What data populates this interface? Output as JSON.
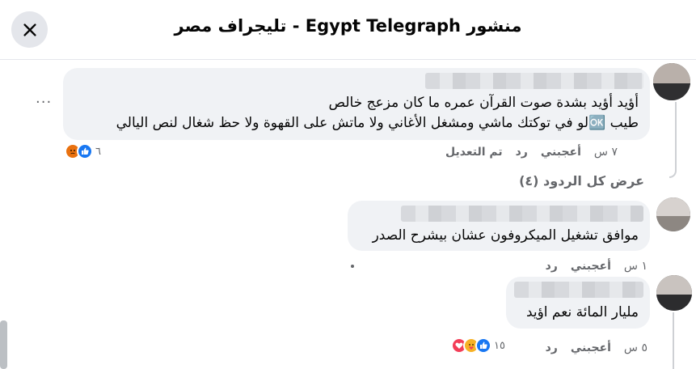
{
  "header": {
    "title": "منشور Egypt Telegraph - تليجراف مصر",
    "close_icon": "close-icon"
  },
  "comments": [
    {
      "line1": "أؤيد أؤيد بشدة صوت القرآن عمره ما كان مزعج خالص",
      "line2": "طيب 🆗لو في توكتك ماشي ومشغل الأغاني ولا ماتش على القهوة ولا حظ شغال لنص اليالي",
      "time": "٧ س",
      "like": "أعجبني",
      "reply": "رد",
      "edited": "تم التعديل",
      "reaction_count": "٦",
      "reactions": [
        "like-icon",
        "angry-icon"
      ],
      "more": "···",
      "view_replies": "عرض كل الردود (٤)"
    },
    {
      "line1": "موافق تشغيل الميكروفون عشان بيشرح الصدر",
      "time": "١ س",
      "like": "أعجبني",
      "reply": "رد"
    },
    {
      "line1": "مليار المائة نعم اؤيد",
      "time": "٥ س",
      "like": "أعجبني",
      "reply": "رد",
      "reaction_count": "١٥",
      "reactions": [
        "like-icon",
        "care-icon",
        "love-icon"
      ]
    }
  ],
  "colors": {
    "bubble": "#f0f2f5",
    "meta_text": "#65676b",
    "like_blue": "#1877f2",
    "angry_orange": "#e9710f",
    "love_red": "#f33e58",
    "care_yellow": "#f7b125"
  }
}
